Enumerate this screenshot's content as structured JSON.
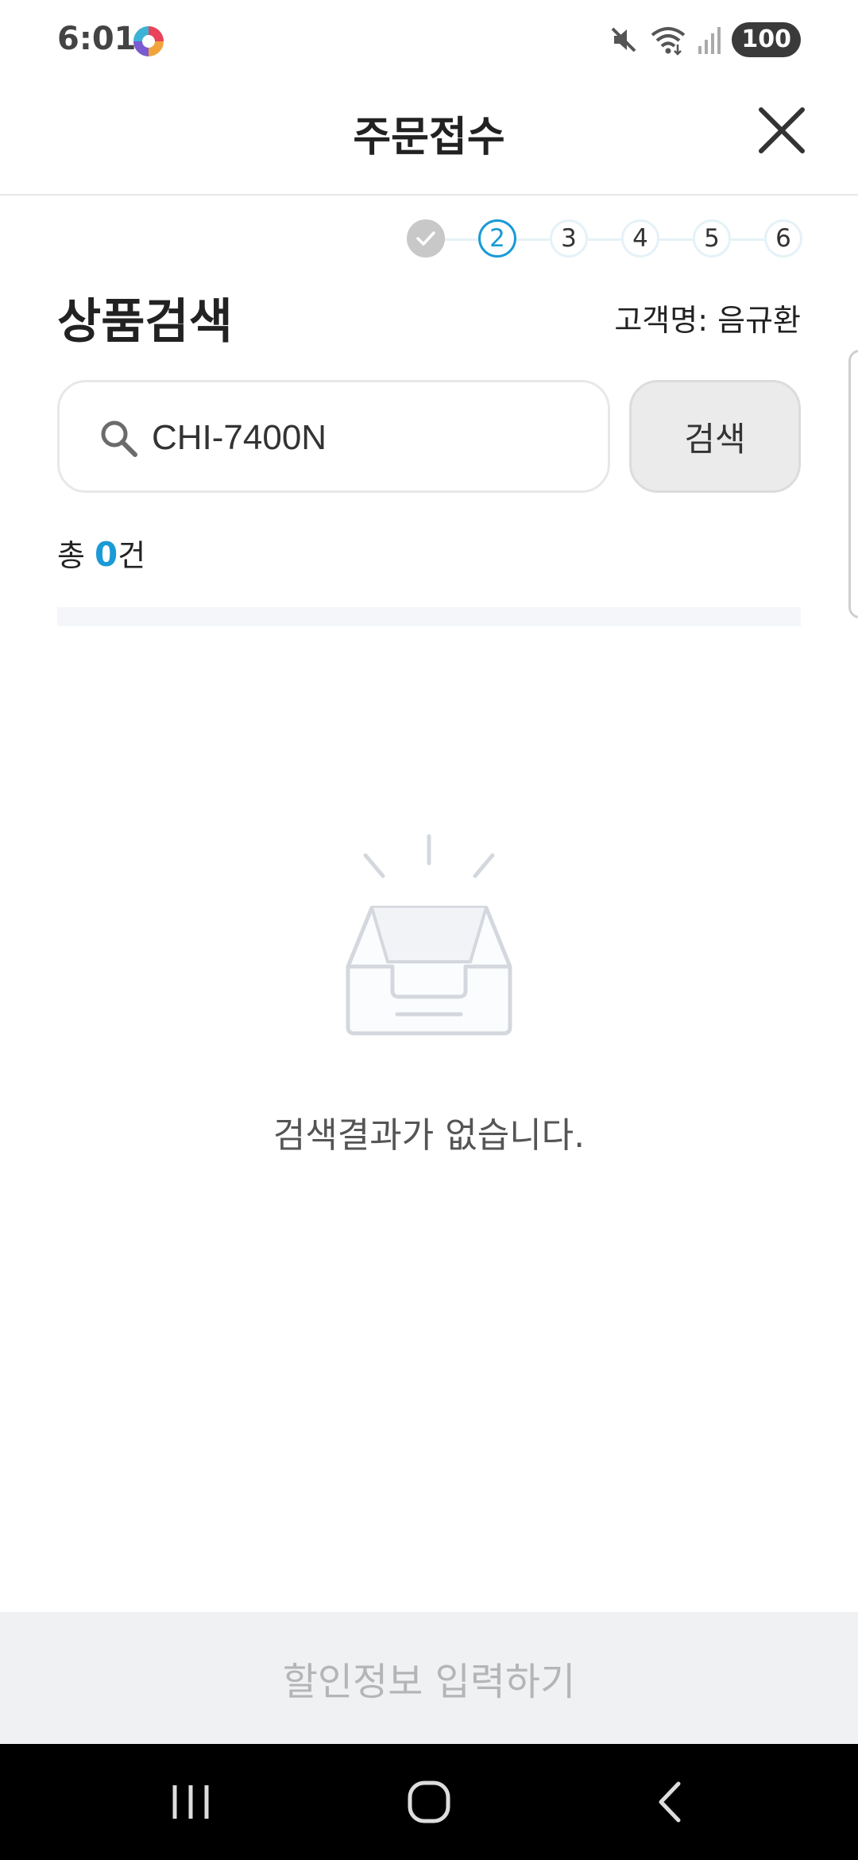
{
  "status_bar": {
    "time": "6:01",
    "battery": "100",
    "icons": [
      "app-color-icon",
      "mute-icon",
      "wifi-icon",
      "signal-icon"
    ]
  },
  "header": {
    "title": "주문접수",
    "close_icon": "close-icon"
  },
  "stepper": {
    "steps": [
      {
        "label": "✓",
        "state": "done"
      },
      {
        "label": "2",
        "state": "active"
      },
      {
        "label": "3",
        "state": "pending"
      },
      {
        "label": "4",
        "state": "pending"
      },
      {
        "label": "5",
        "state": "pending"
      },
      {
        "label": "6",
        "state": "pending"
      }
    ]
  },
  "section": {
    "title": "상품검색",
    "customer": "고객명: 음규환"
  },
  "search": {
    "value": "CHI-7400N",
    "button_label": "검색"
  },
  "results": {
    "total_prefix": "총 ",
    "total_count": "0",
    "total_suffix": "건",
    "empty_message": "검색결과가 없습니다."
  },
  "bottom_action": {
    "label": "할인정보 입력하기"
  },
  "colors": {
    "accent": "#1a9ad6",
    "done_step": "#c8c8c8",
    "bottom_bar_bg": "#f0f1f3"
  }
}
